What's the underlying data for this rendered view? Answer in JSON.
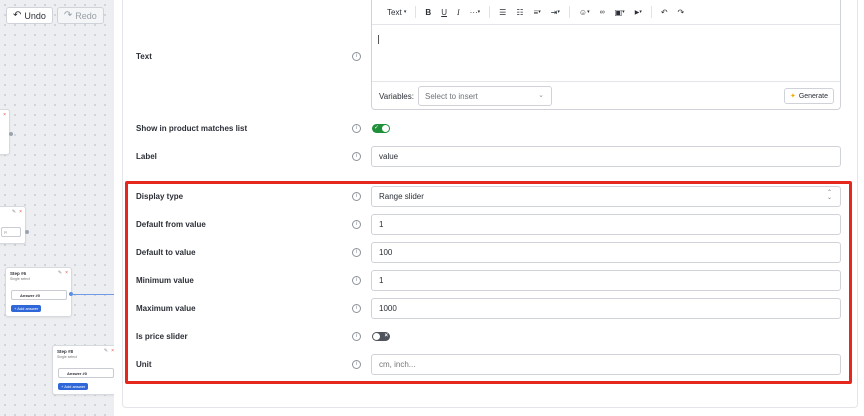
{
  "canvas": {
    "undo_label": "Undo",
    "redo_label": "Redo",
    "nodes": [
      {
        "title": "Step #6",
        "subtitle": "Single select",
        "answer": "Answer #0",
        "add_answer": "+ Add answer"
      },
      {
        "title": "Step #8",
        "subtitle": "Single select",
        "answer": "Answer #0",
        "add_answer": "+ Add answer"
      }
    ]
  },
  "editor": {
    "toolbar": {
      "text_style": "Text",
      "bold": "B",
      "underline": "U",
      "italic": "I",
      "more": "···",
      "bullets": "☰",
      "numbered": "☷",
      "align": "≡",
      "indent": "⇥",
      "emoji": "☺",
      "link": "🔗",
      "image": "▣",
      "video": "▶",
      "undo": "↶",
      "redo": "↷"
    },
    "variables_label": "Variables:",
    "variables_placeholder": "Select to insert",
    "generate_label": "Generate"
  },
  "fields": {
    "text_label": "Text",
    "show_in_matches_label": "Show in product matches list",
    "show_in_matches_on": true,
    "label_label": "Label",
    "label_value": "value",
    "display_type_label": "Display type",
    "display_type_value": "Range slider",
    "default_from_label": "Default from value",
    "default_from_value": "1",
    "default_to_label": "Default to value",
    "default_to_value": "100",
    "min_label": "Minimum value",
    "min_value": "1",
    "max_label": "Maximum value",
    "max_value": "1000",
    "price_slider_label": "Is price slider",
    "price_slider_on": false,
    "unit_label": "Unit",
    "unit_placeholder": "cm, inch..."
  },
  "colors": {
    "highlight": "#e5281d",
    "toggle_on": "#1f8f3a",
    "toggle_off": "#4f545c",
    "add_answer": "#2f67d8"
  }
}
